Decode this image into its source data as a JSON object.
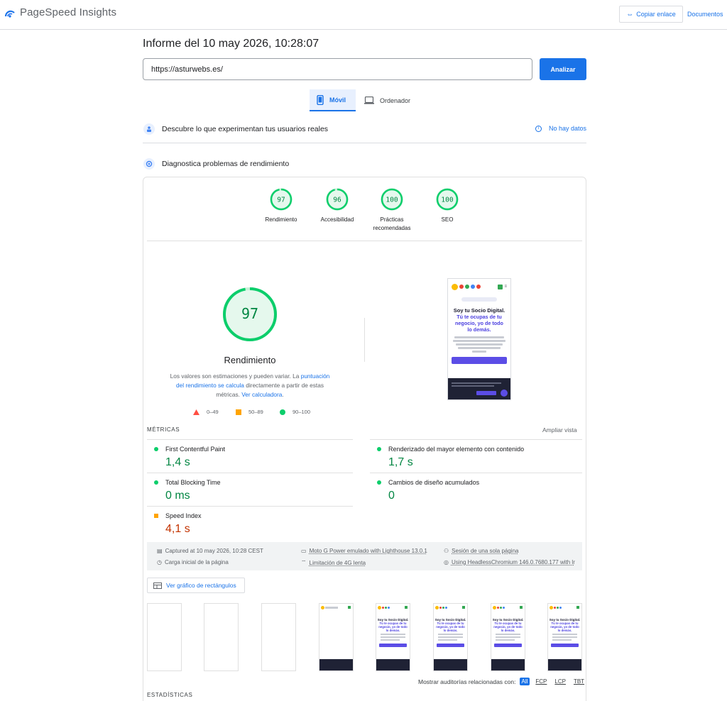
{
  "header": {
    "app_name": "PageSpeed Insights",
    "copy_link": "Copiar enlace",
    "docs_link": "Documentos"
  },
  "report": {
    "title": "Informe del 10 may 2026, 10:28:07",
    "url_value": "https://asturwebs.es/",
    "analyze_label": "Analizar"
  },
  "device_tabs": [
    {
      "label": "Móvil",
      "active": true,
      "icon": "phone-icon"
    },
    {
      "label": "Ordenador",
      "active": false,
      "icon": "desktop-icon"
    }
  ],
  "sections": {
    "real_users": "Descubre lo que experimentan tus usuarios reales",
    "no_data": "No hay datos",
    "diagnose": "Diagnostica problemas de rendimiento"
  },
  "scores": [
    {
      "value": 97,
      "label_lines": [
        "Rendimiento"
      ]
    },
    {
      "value": 96,
      "label_lines": [
        "Accesibilidad"
      ]
    },
    {
      "value": 100,
      "label_lines": [
        "Prácticas",
        "recomendadas"
      ]
    },
    {
      "value": 100,
      "label_lines": [
        "SEO"
      ]
    }
  ],
  "performance": {
    "score": 97,
    "label": "Rendimiento",
    "note_before": "Los valores son estimaciones y pueden variar. La ",
    "note_link1": "puntuación del rendimiento se calcula",
    "note_middle": " directamente a partir de estas métricas. ",
    "note_link2": "Ver calculadora",
    "note_after": "."
  },
  "legend": [
    {
      "range": "0–49",
      "color": "#ff4e42"
    },
    {
      "range": "50–89",
      "color": "#ffa400"
    },
    {
      "range": "90–100",
      "color": "#0cce6b"
    }
  ],
  "screenshot": {
    "badge": "Diseño Web · Desarrollo · SEO",
    "title": "Soy tu Socio Digital.",
    "subtitle_lines": [
      "Tú te ocupas de tu",
      "negocio, yo de todo",
      "lo demás."
    ]
  },
  "metrics": {
    "title": "MÉTRICAS",
    "expand": "Ampliar vista",
    "items": [
      {
        "name": "First Contentful Paint",
        "value": "1,4 s",
        "status": "good"
      },
      {
        "name": "Renderizado del mayor elemento con contenido",
        "value": "1,7 s",
        "status": "good"
      },
      {
        "name": "Total Blocking Time",
        "value": "0 ms",
        "status": "good"
      },
      {
        "name": "Cambios de diseño acumulados",
        "value": "0",
        "status": "good"
      },
      {
        "name": "Speed Index",
        "value": "4,1 s",
        "status": "average"
      }
    ]
  },
  "run_info": {
    "captured": "Captured at 10 may 2026, 10:28 CEST",
    "device": "Moto G Power emulado with Lighthouse 13.0.1",
    "session": "Sesión de una sola página",
    "load": "Carga inicial de la página",
    "throttling": "Limitación de 4G lenta",
    "browser": "Using HeadlessChromium 146.0.7680.177 with lr"
  },
  "treemap_label": "Ver gráfico de rectángulos",
  "filmstrip_count": 8,
  "filter": {
    "label": "Mostrar auditorías relacionadas con:",
    "options": [
      "All",
      "FCP",
      "LCP",
      "TBT"
    ],
    "active": "All"
  },
  "stats_title": "ESTADÍSTICAS",
  "colors": {
    "good": "#0cce6b",
    "good_text": "#018642",
    "average": "#ffa400",
    "average_text": "#c33300",
    "accent": "#1a73e8"
  }
}
